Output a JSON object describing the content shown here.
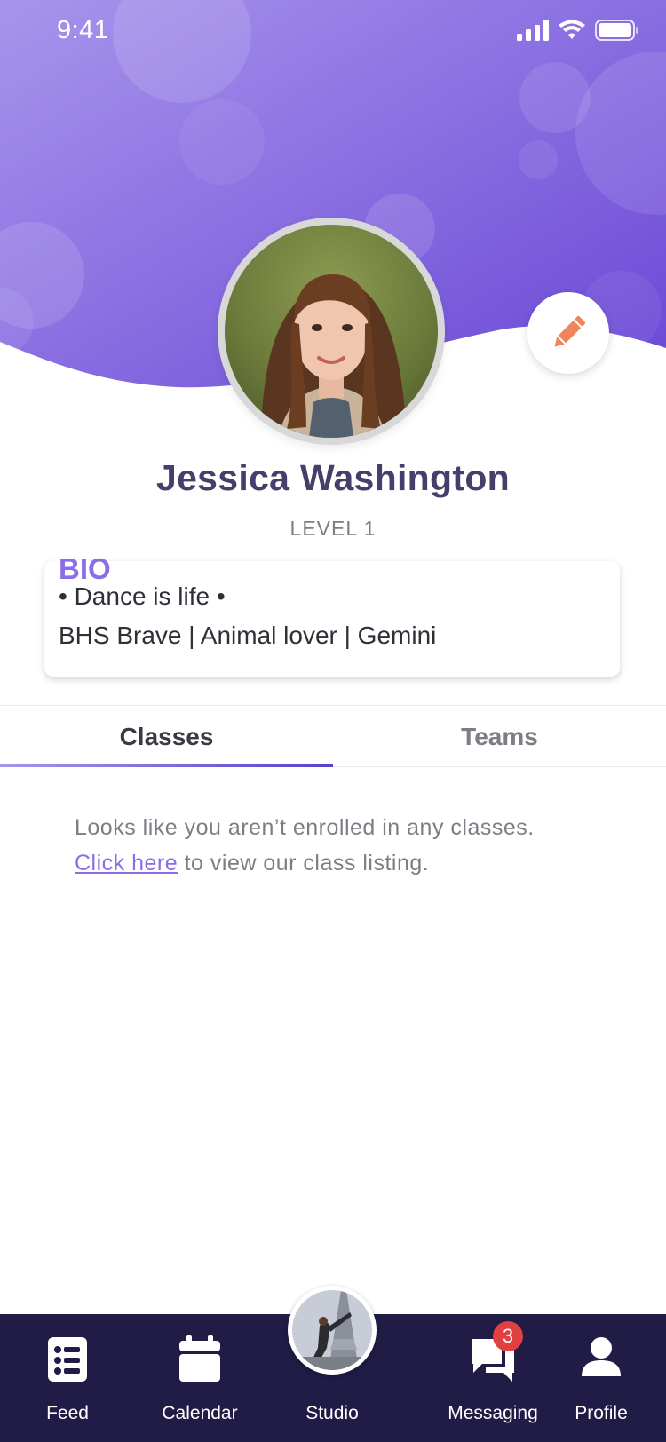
{
  "status_bar": {
    "time": "9:41",
    "signal_icon": "signal-bars-icon",
    "wifi_icon": "wifi-icon",
    "battery_icon": "battery-icon"
  },
  "colors": {
    "hero_gradient_start": "#a795ec",
    "hero_gradient_end": "#6a47d6",
    "accent": "#8a6ee8",
    "edit_icon": "#f2845c",
    "navbar": "#211c46",
    "badge": "#e0413f"
  },
  "profile": {
    "name": "Jessica Washington",
    "level": "LEVEL 1",
    "edit_icon": "pencil-icon",
    "bio": {
      "title": "BIO",
      "lines": [
        "• Dance is life •",
        "BHS Brave | Animal lover | Gemini"
      ]
    }
  },
  "tabs": [
    {
      "label": "Classes",
      "active": true
    },
    {
      "label": "Teams",
      "active": false
    }
  ],
  "empty_state": {
    "message": "Looks like you aren’t enrolled in any classes.",
    "link_text": "Click here",
    "link_suffix": " to view our class listing."
  },
  "nav": {
    "items": [
      {
        "label": "Feed",
        "icon": "feed-list-icon"
      },
      {
        "label": "Calendar",
        "icon": "calendar-icon"
      },
      {
        "label": "Studio",
        "icon": "studio-photo"
      },
      {
        "label": "Messaging",
        "icon": "chat-bubbles-icon",
        "badge": "3"
      },
      {
        "label": "Profile",
        "icon": "person-icon"
      }
    ]
  }
}
